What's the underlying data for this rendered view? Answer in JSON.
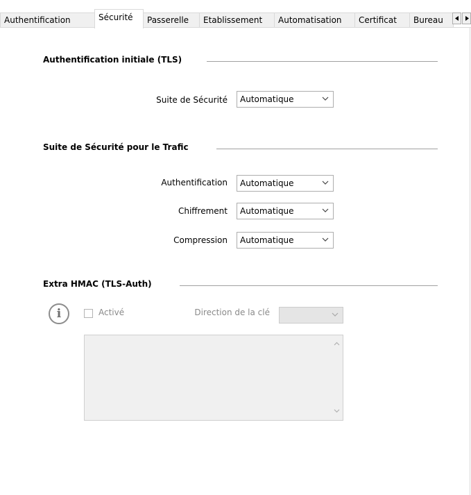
{
  "tabs": [
    {
      "label": "Authentification",
      "active": false
    },
    {
      "label": "Sécurité",
      "active": true
    },
    {
      "label": "Passerelle",
      "active": false
    },
    {
      "label": "Etablissement",
      "active": false
    },
    {
      "label": "Automatisation",
      "active": false
    },
    {
      "label": "Certificat",
      "active": false
    },
    {
      "label": "Bureau",
      "active": false
    }
  ],
  "tab_scroll": {
    "left_icon": "caret-left-icon",
    "right_icon": "caret-right-icon"
  },
  "tls_section": {
    "title": "Authentification initiale (TLS)",
    "suite_label": "Suite de Sécurité",
    "suite_value": "Automatique"
  },
  "traffic_section": {
    "title": "Suite de Sécurité pour le Trafic",
    "auth_label": "Authentification",
    "auth_value": "Automatique",
    "cipher_label": "Chiffrement",
    "cipher_value": "Automatique",
    "compression_label": "Compression",
    "compression_value": "Automatique"
  },
  "hmac_section": {
    "title": "Extra HMAC (TLS-Auth)",
    "info_icon": "info-icon",
    "enabled_label": "Activé",
    "enabled_checked": false,
    "key_direction_label": "Direction de la clé",
    "key_direction_value": ""
  },
  "colors": {
    "section_rule": "#a0a0a0",
    "tab_border": "#d9d9d9",
    "disabled_bg": "#f0f0f0"
  }
}
